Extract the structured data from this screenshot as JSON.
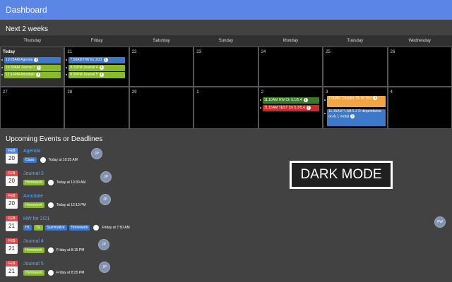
{
  "app": {
    "title": "Dashboard"
  },
  "colors": {
    "topbar": "#5b86e5",
    "blue_event": "#3d78c9",
    "green_event": "#8ab92d",
    "dark_green_event": "#3c7a2a",
    "red_event": "#cc2a2a",
    "orange_event": "#f2a541",
    "feb_red": "#e05050",
    "feb_blue": "#5588d8"
  },
  "calendar": {
    "section_title": "Next 2 weeks",
    "weekdays": [
      "Thursday",
      "Friday",
      "Saturday",
      "Sunday",
      "Monday",
      "Tuesday",
      "Wednesday"
    ],
    "week1": [
      "Today",
      "21",
      "22",
      "23",
      "24",
      "25",
      "26"
    ],
    "week2": [
      "27",
      "28",
      "29",
      "1",
      "2",
      "3",
      "4"
    ],
    "events": {
      "today_1": "10:25AM Agenda",
      "today_2": "10:30AM Journal 3",
      "today_3": "12:10PM Annotate",
      "fri_1": "7:50AM HW for 2/21",
      "fri_2": "8:15PM Journal 4",
      "fri_3": "8:25PM Journal 5",
      "mon_1": "11:10AM HW Ch 5.1/5.4",
      "mon_2": "11:15AM TEST Ch 5.1/5.4",
      "tue_1": "7:50AM Chapter 15-16 Test",
      "tue_2": "11:15AM *LAB 5.2 R dependance on A, l, metal"
    }
  },
  "upcoming": {
    "section_title": "Upcoming Events or Deadlines",
    "items": [
      {
        "month": "FEB",
        "day": "20",
        "title": "Agenda",
        "tags": [
          "Class"
        ],
        "when": "Today at 10:25 AM",
        "avatar": "JP"
      },
      {
        "month": "FEB",
        "day": "20",
        "title": "Journal 3",
        "tags": [
          "Homework"
        ],
        "when": "Today at 10:30 AM",
        "avatar": "JP"
      },
      {
        "month": "FEB",
        "day": "20",
        "title": "Annotate",
        "tags": [
          "Homework"
        ],
        "when": "Today at 12:10 PM",
        "avatar": "JP"
      },
      {
        "month": "FEB",
        "day": "21",
        "title": "HW for 2/21",
        "tags": [
          "HL",
          "SL",
          "Summative",
          "Homework"
        ],
        "when": "Friday at 7:50 AM",
        "avatar": "PW"
      },
      {
        "month": "FEB",
        "day": "21",
        "title": "Journal 4",
        "tags": [
          "Homework"
        ],
        "when": "Friday at 8:15 PM",
        "avatar": "JP"
      },
      {
        "month": "FEB",
        "day": "21",
        "title": "Journal 5",
        "tags": [
          "Homework"
        ],
        "when": "Friday at 8:25 PM",
        "avatar": "JP"
      }
    ]
  },
  "overlay": {
    "dark_mode_label": "DARK MODE"
  }
}
